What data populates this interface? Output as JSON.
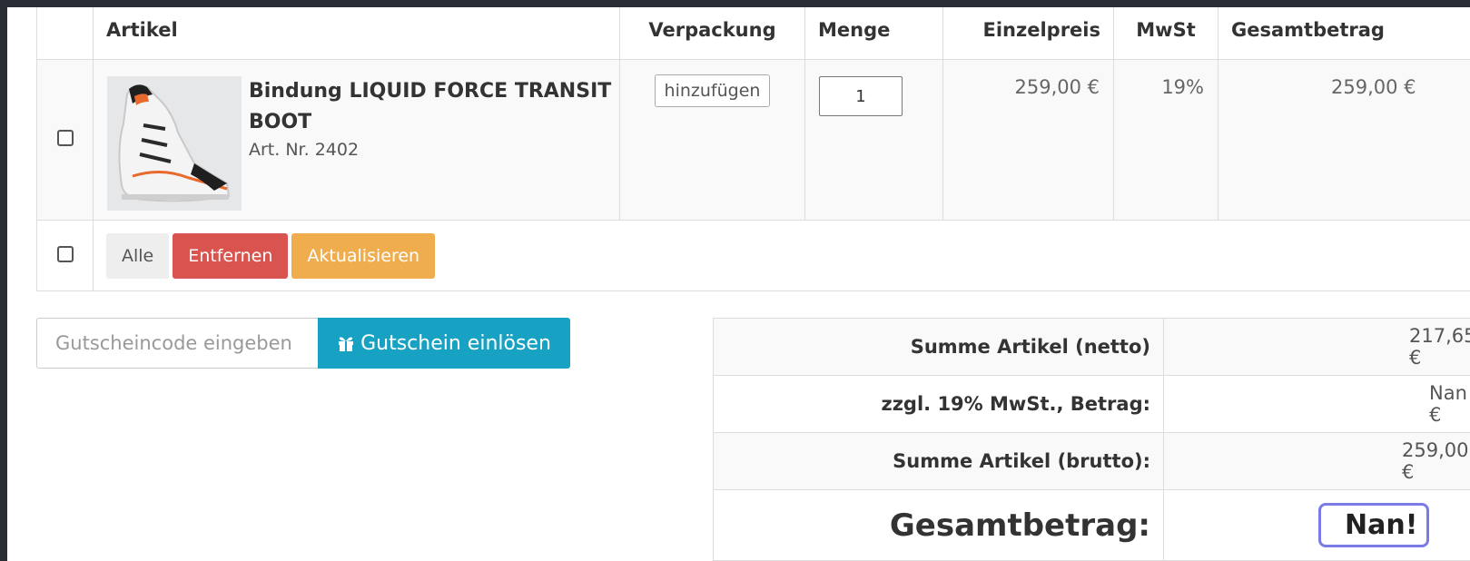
{
  "table": {
    "headers": {
      "article": "Artikel",
      "packaging": "Verpackung",
      "quantity": "Menge",
      "unit_price": "Einzelpreis",
      "vat": "MwSt",
      "total": "Gesamtbetrag"
    },
    "item": {
      "name": "Bindung LIQUID FORCE TRANSIT BOOT",
      "art_nr": "Art. Nr. 2402",
      "packaging_button": "hinzufügen",
      "quantity": "1",
      "unit_price": "259,00 €",
      "vat": "19%",
      "total": "259,00 €"
    },
    "actions": {
      "all": "Alle",
      "remove": "Entfernen",
      "update": "Aktualisieren"
    }
  },
  "coupon": {
    "placeholder": "Gutscheincode eingeben",
    "button": "Gutschein einlösen"
  },
  "totals": {
    "net_label": "Summe Artikel (netto)",
    "net_value": "217,65 €",
    "vat_label": "zzgl. 19% MwSt., Betrag:",
    "vat_value": "Nan! €",
    "gross_label": "Summe Artikel (brutto):",
    "gross_value": "259,00 €",
    "grand_label": "Gesamtbetrag:",
    "grand_value": "Nan!"
  },
  "colors": {
    "remove": "#d9534f",
    "update": "#f0ad4e",
    "coupon": "#17a2c3",
    "highlight": "#7b7be6"
  }
}
